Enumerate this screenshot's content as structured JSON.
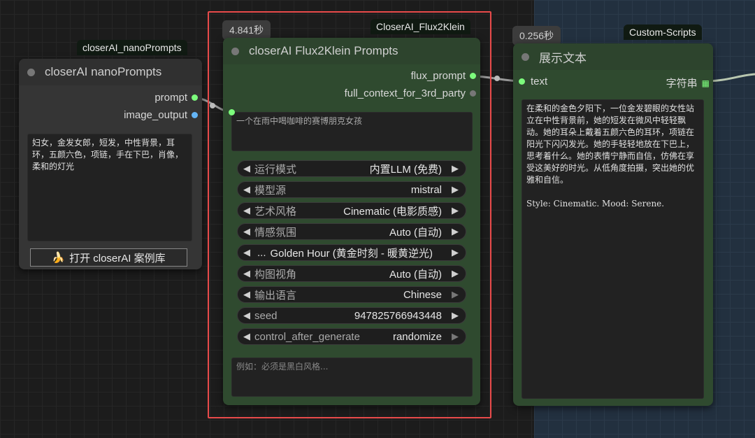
{
  "colors": {
    "canvas_bg": "#1c1c1c",
    "group_bg": "#22303f",
    "node_gray": "#353535",
    "node_green": "#2f4a2f",
    "selection": "#e84a4a",
    "string_port": "#7cfc7c",
    "image_port": "#64b5f6"
  },
  "node_nano": {
    "badge": "closerAI_nanoPrompts",
    "title": "closerAI nanoPrompts",
    "outputs": [
      "prompt",
      "image_output"
    ],
    "text": "妇女，金发女郎，短发，中性背景，耳环，五颜六色，项链，手在下巴，肖像，柔和的灯光",
    "button_icon": "🍌",
    "button_label": "打开 closerAI 案例库"
  },
  "node_flux": {
    "time": "4.841秒",
    "badge": "CloserAI_Flux2Klein",
    "title": "closerAI Flux2Klein Prompts",
    "outputs": [
      "flux_prompt",
      "full_context_for_3rd_party"
    ],
    "input_text": "一个在雨中喝咖啡的赛博朋克女孩",
    "widgets": [
      {
        "label": "运行模式",
        "value": "内置LLM (免费)"
      },
      {
        "label": "模型源",
        "value": "mistral"
      },
      {
        "label": "艺术风格",
        "value": "Cinematic (电影质感)"
      },
      {
        "label": "情感氛围",
        "value": "Auto (自动)"
      },
      {
        "label": "...",
        "value": "Golden Hour (黄金时刻 - 暖黄逆光)"
      },
      {
        "label": "构图视角",
        "value": "Auto (自动)"
      },
      {
        "label": "输出语言",
        "value": "Chinese"
      },
      {
        "label": "seed",
        "value": "947825766943448"
      },
      {
        "label": "control_after_generate",
        "value": "randomize"
      }
    ],
    "extra_placeholder": "例如：必须是黑白风格..."
  },
  "node_show": {
    "time": "0.256秒",
    "badge": "Custom-Scripts",
    "title": "展示文本",
    "input_label": "text",
    "output_label": "字符串",
    "output_icon": "grid-icon",
    "text": "在柔和的金色夕阳下，一位金发碧眼的女性站立在中性背景前，她的短发在微风中轻轻飘动。她的耳朵上戴着五颜六色的耳环，项链在阳光下闪闪发光。她的手轻轻地放在下巴上，思考着什么。她的表情宁静而自信，仿佛在享受这美好的时光。从低角度拍摄，突出她的优雅和自信。\n\nStyle: Cinematic. Mood: Serene."
  }
}
